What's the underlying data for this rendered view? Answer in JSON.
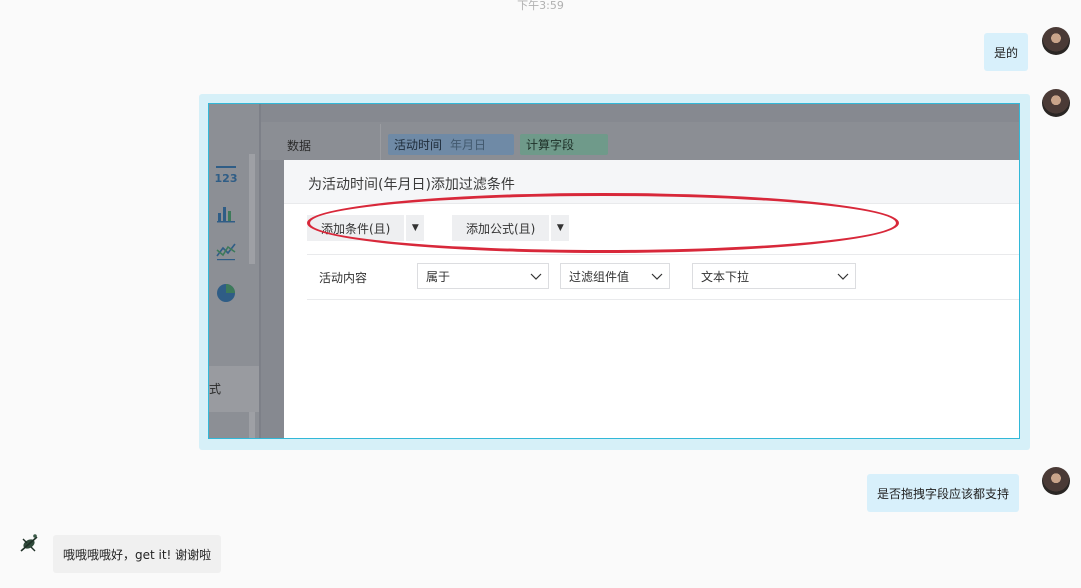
{
  "timestamp": "下午3:59",
  "messages": [
    {
      "side": "right",
      "text": "是的"
    },
    {
      "side": "right",
      "type": "screenshot"
    },
    {
      "side": "right",
      "text": "是否拖拽字段应该都支持"
    },
    {
      "side": "left",
      "text": "哦哦哦哦好，get it!  谢谢啦"
    }
  ],
  "screenshot": {
    "background": {
      "data_label": "数据",
      "chip_field": "活动时间",
      "chip_field_sub": "年月日",
      "chip_calc": "计算字段",
      "side_text": "式",
      "icons": [
        "number-123-icon",
        "bar-chart-icon",
        "line-chart-icon",
        "pie-chart-icon"
      ]
    },
    "dialog": {
      "title": "为活动时间(年月日)添加过滤条件",
      "add_condition": "添加条件(且)",
      "add_formula": "添加公式(且)",
      "row": {
        "field": "活动内容",
        "operator": "属于",
        "value_type": "过滤组件值",
        "widget": "文本下拉"
      }
    },
    "annotation_color": "#d8283a"
  },
  "colors": {
    "bubble_blue": "#d8f0fb",
    "bubble_grey": "#f0f0f0",
    "screenshot_border": "#32b8d8"
  }
}
